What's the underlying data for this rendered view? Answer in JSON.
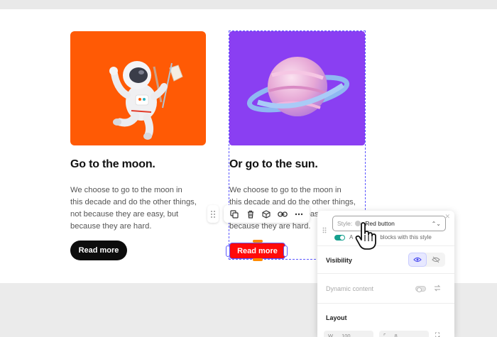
{
  "cards": [
    {
      "title": "Go to the moon.",
      "body": "We choose to go to the moon in this decade and do the other things, not because they are easy, but because they are hard.",
      "button": "Read more",
      "image": "astronaut-illustration",
      "image_bg": "#ff5a05"
    },
    {
      "title": "Or go to the sun.",
      "body": "We choose to go to the moon in this decade and do the other things, not because they are easy, but because they are hard.",
      "button": "Read more",
      "image": "planet-illustration",
      "image_bg": "#8a3ff2",
      "button_color": "#ff0a0a"
    }
  ],
  "toolbar": {
    "icons": [
      "drag-handle-icon",
      "duplicate-icon",
      "delete-icon",
      "block-icon",
      "link-icon",
      "more-icon"
    ]
  },
  "style_panel": {
    "style_label": "Style:",
    "style_value": "Red button",
    "apply_text_start": "A",
    "apply_text_end": "blocks with this style",
    "visibility_label": "Visibility",
    "dynamic_content_label": "Dynamic content",
    "layout_label": "Layout",
    "layout_w_label": "W",
    "layout_w_value": "100",
    "layout_radius_value": "8"
  },
  "colors": {
    "selection": "#5b57ff",
    "toggle_on": "#16a08e"
  }
}
